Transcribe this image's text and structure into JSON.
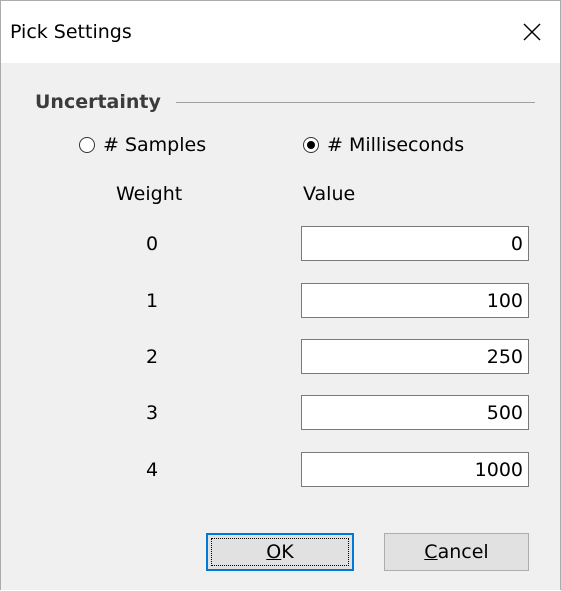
{
  "window": {
    "title": "Pick Settings",
    "close_label": "×"
  },
  "group": {
    "label": "Uncertainty"
  },
  "radio": {
    "samples_label": "# Samples",
    "milliseconds_label": "# Milliseconds",
    "selected": "milliseconds"
  },
  "table": {
    "weight_header": "Weight",
    "value_header": "Value",
    "rows": [
      {
        "weight": "0",
        "value": "0"
      },
      {
        "weight": "1",
        "value": "100"
      },
      {
        "weight": "2",
        "value": "250"
      },
      {
        "weight": "3",
        "value": "500"
      },
      {
        "weight": "4",
        "value": "1000"
      }
    ]
  },
  "buttons": {
    "ok_mnemonic": "O",
    "ok_rest": "K",
    "cancel_mnemonic": "C",
    "cancel_rest": "ancel"
  }
}
